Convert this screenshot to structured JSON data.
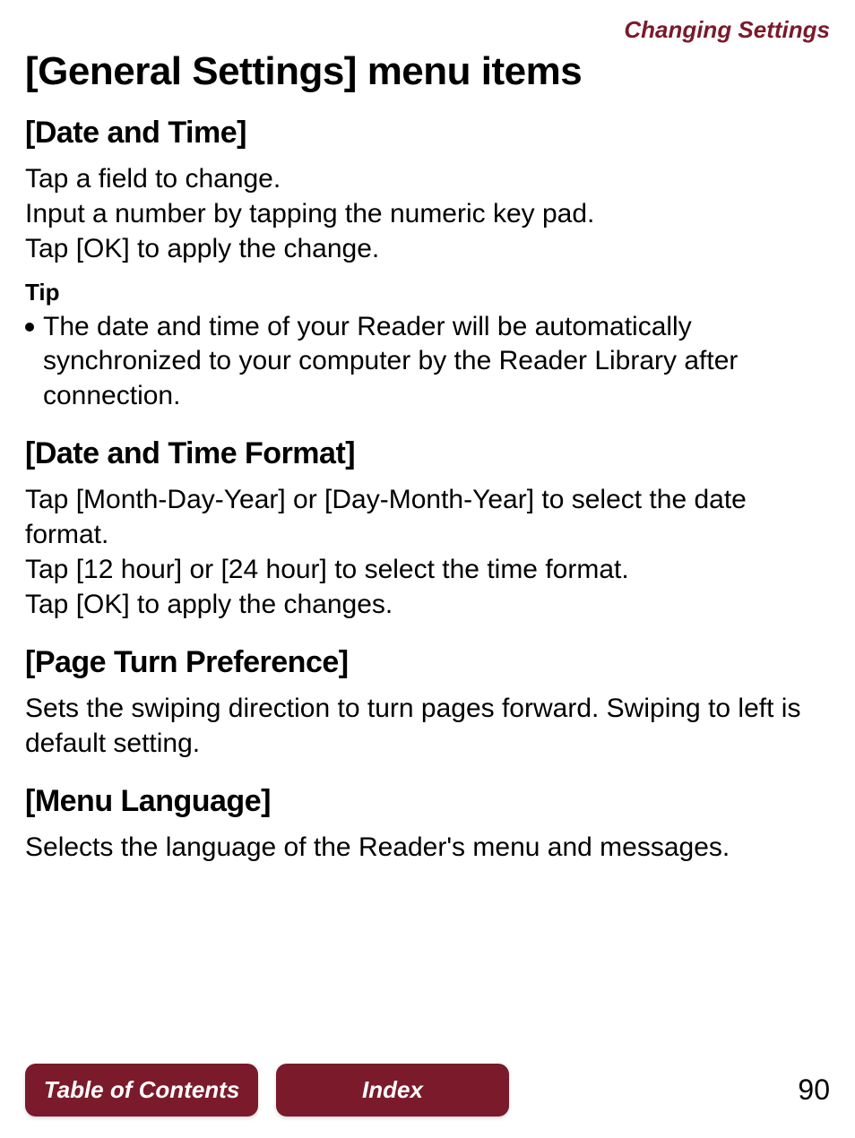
{
  "header": {
    "section_link": "Changing Settings"
  },
  "title": "[General Settings] menu items",
  "sections": [
    {
      "heading": "[Date and Time]",
      "body": "Tap a field to change.\nInput a number by tapping the numeric key pad.\nTap [OK] to apply the change.",
      "tip_label": "Tip",
      "tip_bullet": "The date and time of your Reader will be automatically synchronized to your computer by the Reader Library after connection."
    },
    {
      "heading": "[Date and Time Format]",
      "body": "Tap [Month-Day-Year] or [Day-Month-Year] to select the date format.\nTap [12 hour] or [24 hour] to select the time format.\nTap [OK] to apply the changes."
    },
    {
      "heading": "[Page Turn Preference]",
      "body": "Sets the swiping direction to turn pages forward. Swiping to left is default setting."
    },
    {
      "heading": "[Menu Language]",
      "body": "Selects the language of the Reader's menu and messages."
    }
  ],
  "footer": {
    "toc_button": "Table of Contents",
    "index_button": "Index",
    "page_number": "90"
  }
}
